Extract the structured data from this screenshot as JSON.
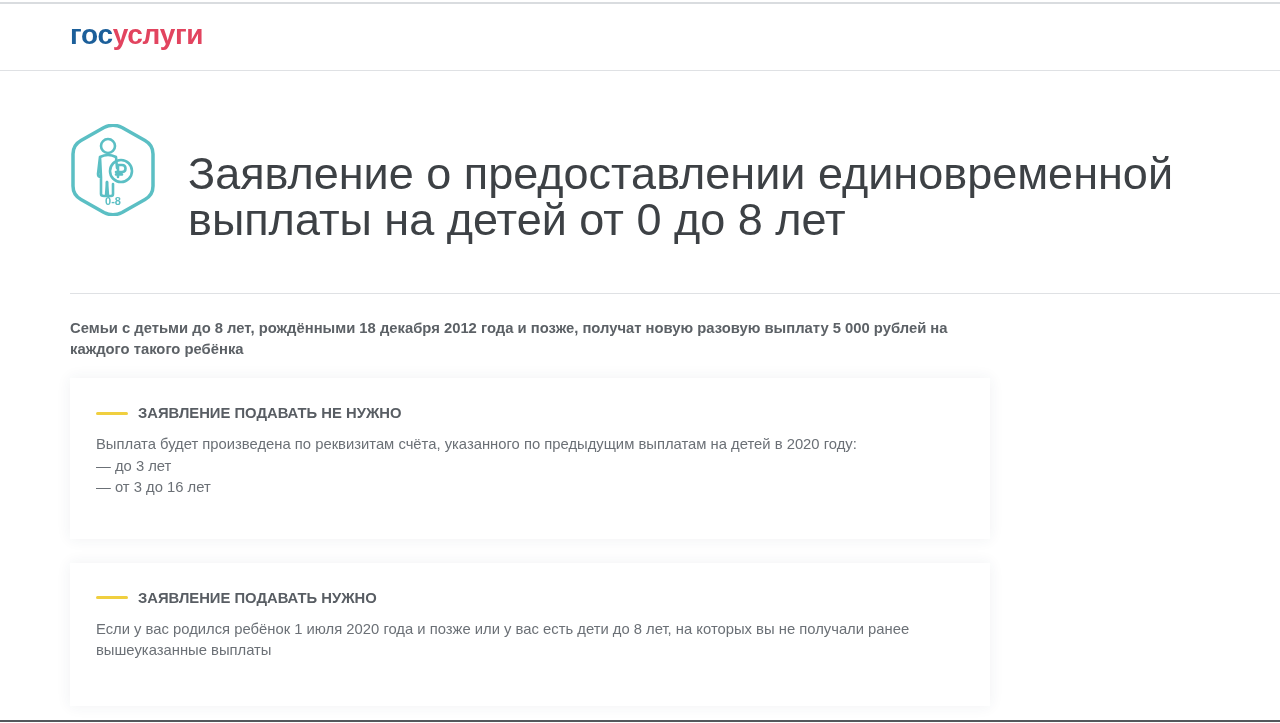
{
  "header": {
    "logo": {
      "first": "гос",
      "second": "услуги"
    }
  },
  "service": {
    "icon_label": "0-8",
    "title": "Заявление о предоставлении единовременной выплаты на детей от 0 до 8 лет"
  },
  "intro": "Семьи с детьми до 8 лет, рождёнными 18 декабря 2012 года и позже, получат новую разовую выплату 5 000 рублей на каждого такого ребёнка",
  "cards": [
    {
      "title": "ЗАЯВЛЕНИЕ ПОДАВАТЬ НЕ НУЖНО",
      "lines": [
        "Выплата будет произведена по реквизитам счёта, указанного по предыдущим выплатам на детей в 2020 году:",
        "— до 3 лет",
        "— от 3 до 16 лет"
      ]
    },
    {
      "title": "ЗАЯВЛЕНИЕ ПОДАВАТЬ НУЖНО",
      "lines": [
        "Если у вас родился ребёнок 1 июля 2020 года и позже или у вас есть дети до 8 лет, на которых вы не получали ранее вышеуказанные выплаты"
      ]
    }
  ]
}
